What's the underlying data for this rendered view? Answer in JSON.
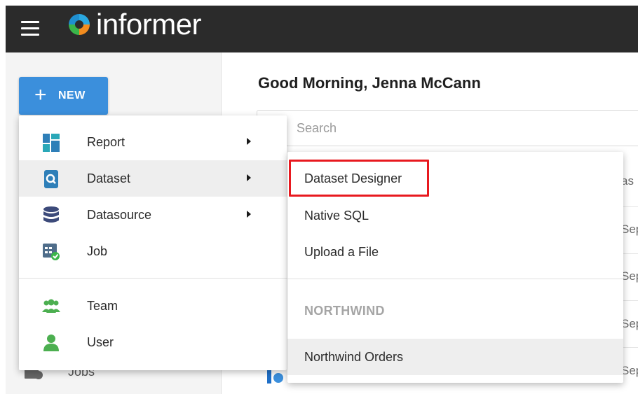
{
  "app": {
    "brand": "informer",
    "brand_colors": {
      "topbar": "#2b2b2b",
      "new_button": "#3b8fdc",
      "highlight": "#e8191f"
    }
  },
  "topbar": {
    "menu_icon": "hamburger-icon",
    "logo_icon": "informer-logo-icon"
  },
  "sidebar": {
    "new_button": {
      "icon": "plus-icon",
      "label": "NEW"
    },
    "jobs_item": {
      "icon": "jobs-icon",
      "label": "Jobs"
    }
  },
  "main": {
    "greeting": "Good Morning, Jenna McCann",
    "search": {
      "placeholder": "Search"
    },
    "list_edge": [
      "as",
      "Sep",
      "Sep",
      "Sep",
      "Sep"
    ]
  },
  "new_menu": {
    "items": [
      {
        "label": "Report",
        "icon": "report-icon",
        "has_submenu": true
      },
      {
        "label": "Dataset",
        "icon": "dataset-icon",
        "has_submenu": true,
        "active": true
      },
      {
        "label": "Datasource",
        "icon": "database-icon",
        "has_submenu": true
      },
      {
        "label": "Job",
        "icon": "job-icon",
        "has_submenu": false
      },
      {
        "label": "Team",
        "icon": "team-icon",
        "has_submenu": false
      },
      {
        "label": "User",
        "icon": "user-icon",
        "has_submenu": false
      }
    ]
  },
  "dataset_submenu": {
    "items": [
      {
        "label": "Dataset Designer",
        "highlighted": true
      },
      {
        "label": "Native SQL"
      },
      {
        "label": "Upload a File"
      }
    ],
    "section_header": "NORTHWIND",
    "section_items": [
      {
        "label": "Northwind Orders"
      }
    ]
  }
}
